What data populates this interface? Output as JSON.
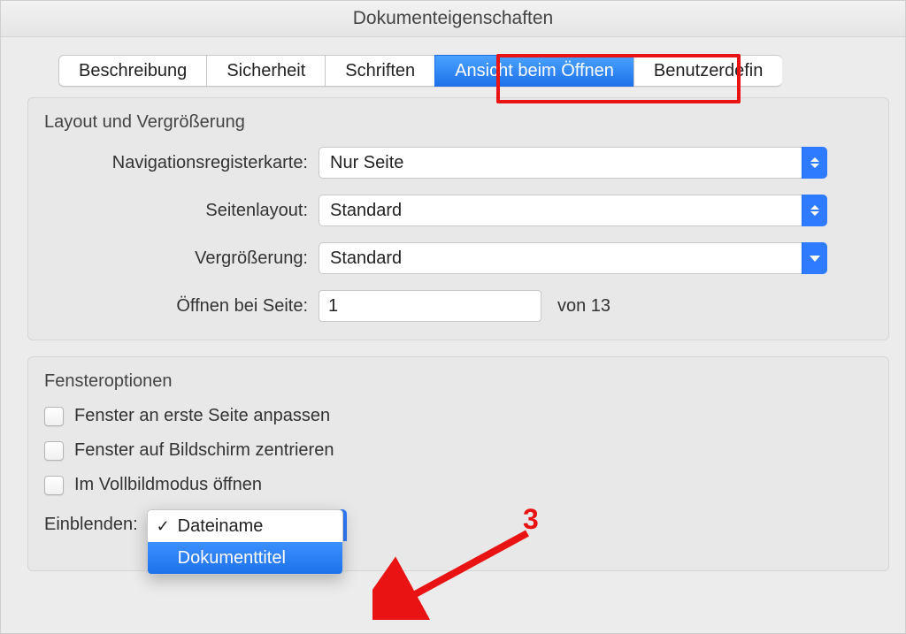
{
  "window": {
    "title": "Dokumenteigenschaften"
  },
  "tabs": {
    "items": [
      {
        "label": "Beschreibung"
      },
      {
        "label": "Sicherheit"
      },
      {
        "label": "Schriften"
      },
      {
        "label": "Ansicht beim Öffnen"
      },
      {
        "label": "Benutzerdefin"
      }
    ],
    "active_index": 3
  },
  "layout_group": {
    "title": "Layout und Vergrößerung",
    "nav_label": "Navigationsregisterkarte:",
    "nav_value": "Nur Seite",
    "pagelayout_label": "Seitenlayout:",
    "pagelayout_value": "Standard",
    "zoom_label": "Vergrößerung:",
    "zoom_value": "Standard",
    "openpage_label": "Öffnen bei Seite:",
    "openpage_value": "1",
    "pagecount_text": "von 13"
  },
  "window_group": {
    "title": "Fensteroptionen",
    "opt1": "Fenster an erste Seite anpassen",
    "opt2": "Fenster auf Bildschirm zentrieren",
    "opt3": "Im Vollbildmodus öffnen",
    "show_label": "Einblenden:",
    "dropdown": {
      "options": [
        {
          "label": "Dateiname"
        },
        {
          "label": "Dokumenttitel"
        }
      ],
      "checked_index": 0,
      "highlighted_index": 1
    }
  },
  "annotations": {
    "number": "3"
  }
}
